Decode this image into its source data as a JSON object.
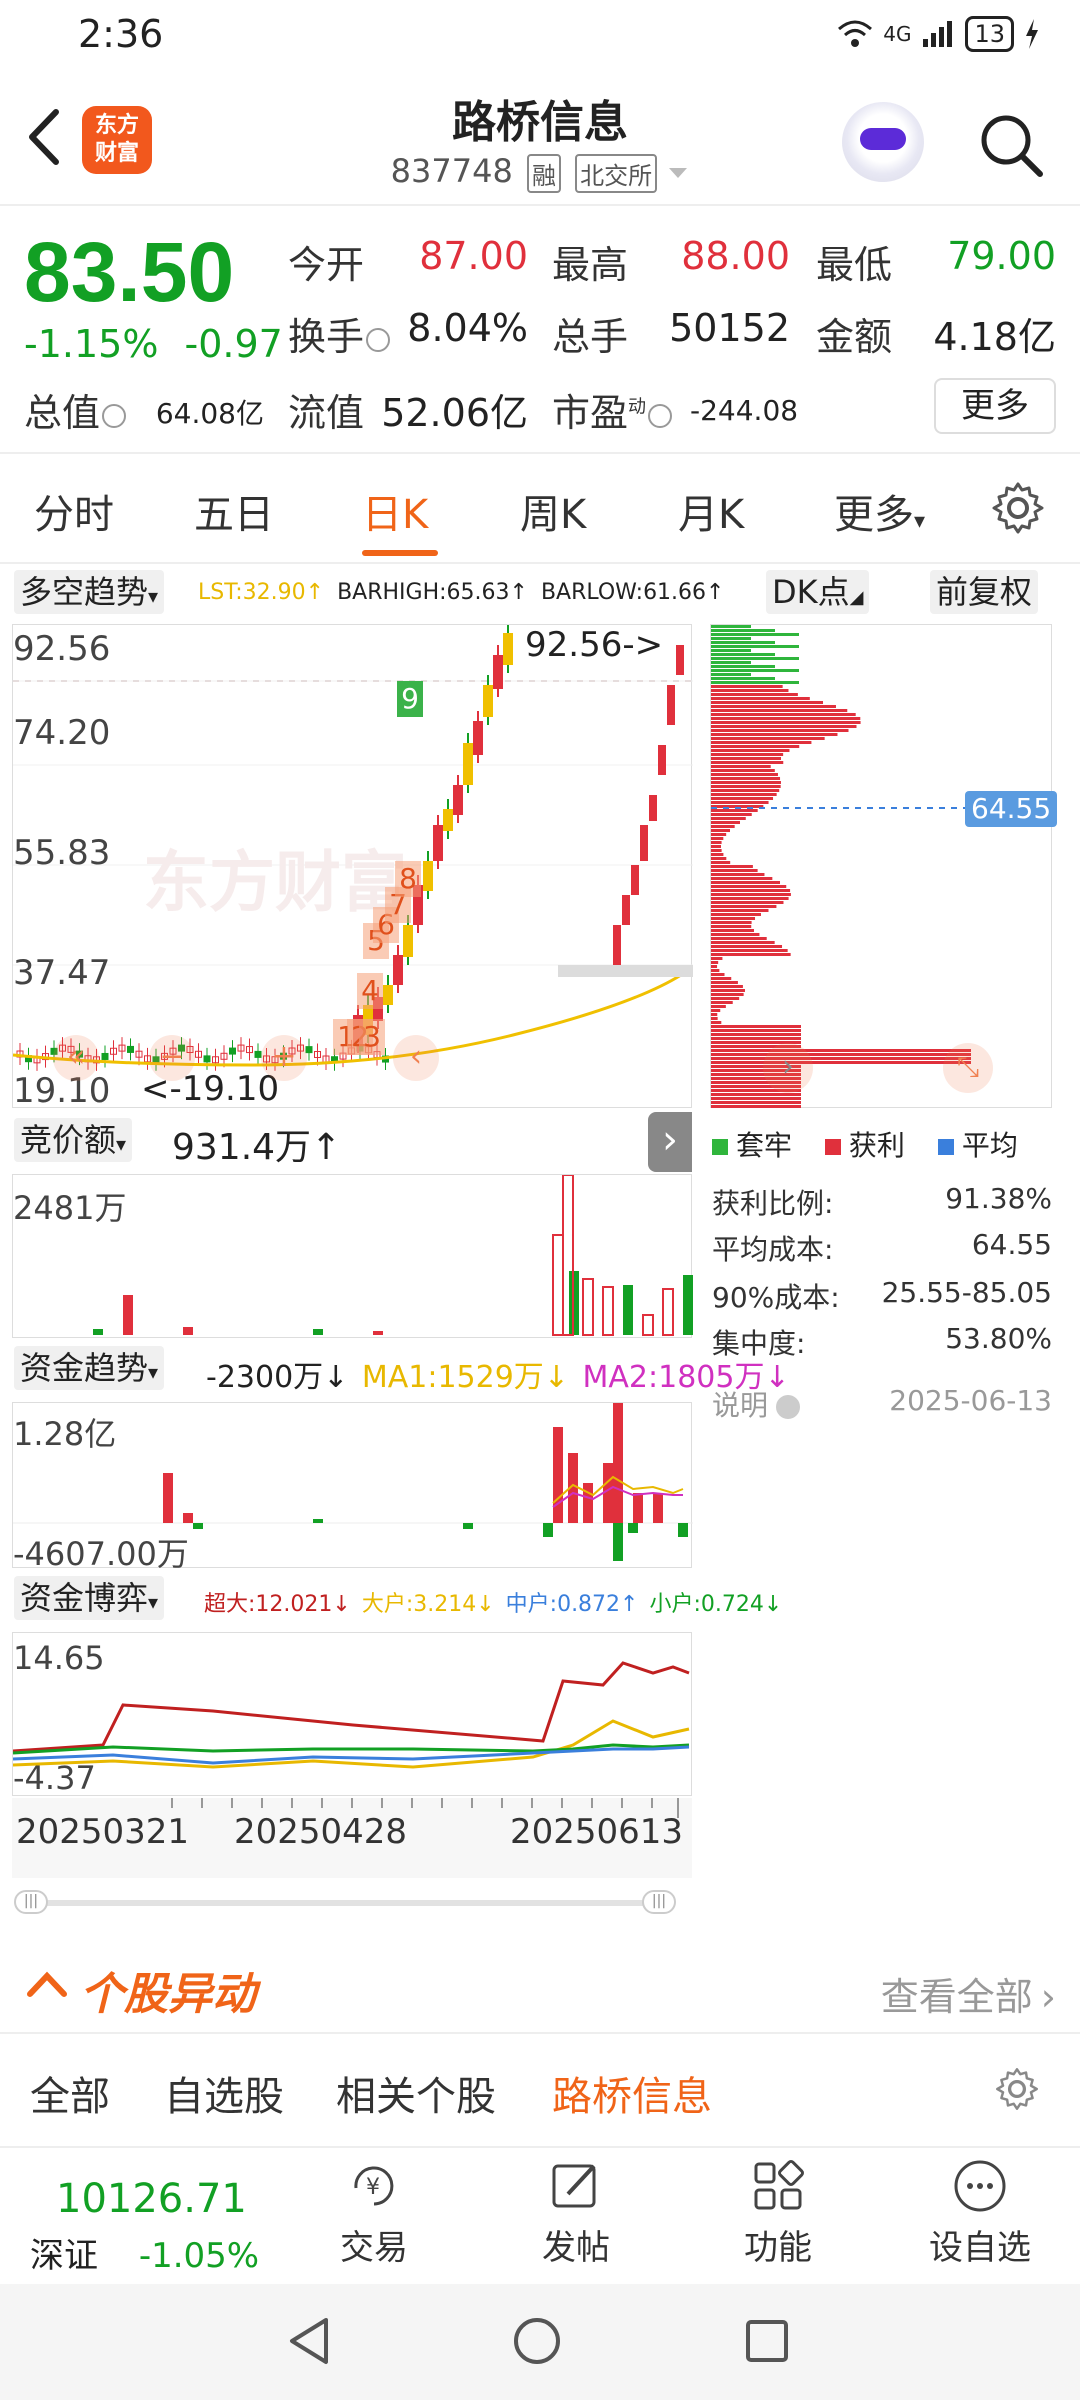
{
  "status_bar": {
    "time": "2:36",
    "network": "4G",
    "battery": "13"
  },
  "header": {
    "logo_line1": "东方",
    "logo_line2": "财富",
    "name": "路桥信息",
    "code": "837748",
    "tag1": "融",
    "tag2": "北交所"
  },
  "quote": {
    "price": "83.50",
    "change_pct": "-1.15%",
    "change_amt": "-0.97",
    "open_label": "今开",
    "open": "87.00",
    "high_label": "最高",
    "high": "88.00",
    "low_label": "最低",
    "low": "79.00",
    "turnover_label": "换手",
    "turnover": "8.04%",
    "volume_label": "总手",
    "volume": "50152",
    "amount_label": "金额",
    "amount": "4.18亿",
    "mktcap_label": "总值",
    "mktcap": "64.08亿",
    "float_label": "流值",
    "float": "52.06亿",
    "pe_label": "市盈",
    "pe_super": "动",
    "pe": "-244.08",
    "more": "更多"
  },
  "tabs": [
    "分时",
    "五日",
    "日K",
    "周K",
    "月K",
    "更多"
  ],
  "kline": {
    "indicator": "多空趋势",
    "lst": "LST:32.90↑",
    "barhigh": "BARHIGH:65.63↑",
    "barlow": "BARLOW:61.66↑",
    "dk_label": "DK点",
    "adjust_label": "前复权",
    "y_labels": [
      "92.56",
      "74.20",
      "55.83",
      "37.47",
      "19.10"
    ],
    "high_marker": "92.56->",
    "low_marker": "<-19.10",
    "watermark": "东方财富",
    "signals": [
      "1",
      "2",
      "3",
      "4",
      "5",
      "6",
      "7",
      "8",
      "9"
    ],
    "cost_line": "64.55"
  },
  "bid": {
    "label": "竞价额",
    "value": "931.4万↑",
    "axis_top": "2481万"
  },
  "fund_trend": {
    "label": "资金趋势",
    "value": "-2300万↓",
    "ma1": "MA1:1529万↓",
    "ma2": "MA2:1805万↓",
    "axis_top": "1.28亿",
    "axis_bottom": "-4607.00万"
  },
  "fund_game": {
    "label": "资金博弈",
    "super": "超大:12.021↓",
    "large": "大户:3.214↓",
    "medium": "中户:0.872↑",
    "small": "小户:0.724↓",
    "axis_top": "14.65",
    "axis_bottom": "-4.37"
  },
  "x_axis": [
    "20250321",
    "20250428",
    "20250613"
  ],
  "chip": {
    "legend": [
      "套牢",
      "获利",
      "平均"
    ],
    "profit_ratio_label": "获利比例:",
    "profit_ratio": "91.38%",
    "avg_cost_label": "平均成本:",
    "avg_cost": "64.55",
    "cost90_label": "90%成本:",
    "cost90": "25.55-85.05",
    "concentration_label": "集中度:",
    "concentration": "53.80%",
    "note_label": "说明",
    "date": "2025-06-13"
  },
  "anomaly": {
    "title": "个股异动",
    "view_all": "查看全部"
  },
  "filters": [
    "全部",
    "自选股",
    "相关个股",
    "路桥信息"
  ],
  "bottom": {
    "index_value": "10126.71",
    "index_name": "深证",
    "index_change": "-1.05%",
    "nav": [
      "交易",
      "发帖",
      "功能",
      "设自选"
    ]
  },
  "colors": {
    "up": "#e0303c",
    "down": "#12a024",
    "accent": "#f06418",
    "ma_yellow": "#f0c000"
  },
  "chart_data": [
    {
      "type": "candlestick",
      "title": "日K",
      "ylim": [
        19.1,
        92.56
      ],
      "x": [
        "20250321",
        "20250428",
        "20250613"
      ],
      "series": [
        {
          "name": "LST",
          "values": [
            32.9
          ]
        },
        {
          "name": "BARHIGH",
          "values": [
            65.63
          ]
        },
        {
          "name": "BARLOW",
          "values": [
            61.66
          ]
        }
      ],
      "annotations": [
        "92.56",
        "19.10"
      ]
    },
    {
      "type": "bar",
      "title": "竞价额",
      "ylim": [
        0,
        2481
      ],
      "series": [
        {
          "name": "竞价额",
          "values": [
            931.4
          ]
        }
      ]
    },
    {
      "type": "bar",
      "title": "资金趋势",
      "ylim": [
        -4607.0,
        12800
      ],
      "series": [
        {
          "name": "资金趋势",
          "values": [
            -2300
          ]
        },
        {
          "name": "MA1",
          "values": [
            1529
          ]
        },
        {
          "name": "MA2",
          "values": [
            1805
          ]
        }
      ]
    },
    {
      "type": "line",
      "title": "资金博弈",
      "ylim": [
        -4.37,
        14.65
      ],
      "series": [
        {
          "name": "超大",
          "values": [
            12.021
          ]
        },
        {
          "name": "大户",
          "values": [
            3.214
          ]
        },
        {
          "name": "中户",
          "values": [
            0.872
          ]
        },
        {
          "name": "小户",
          "values": [
            0.724
          ]
        }
      ]
    }
  ]
}
